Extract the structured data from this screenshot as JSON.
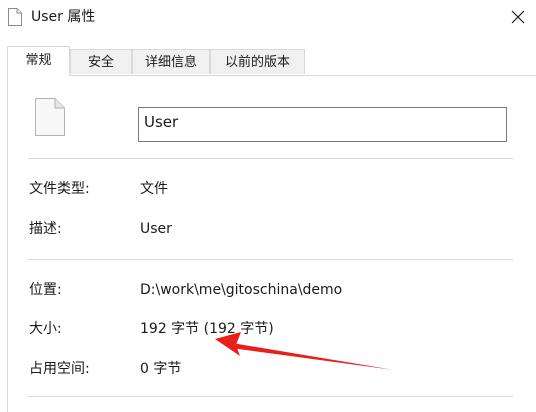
{
  "window": {
    "title": "User 属性"
  },
  "tabs": [
    {
      "label": "常规",
      "active": true
    },
    {
      "label": "安全",
      "active": false
    },
    {
      "label": "详细信息",
      "active": false
    },
    {
      "label": "以前的版本",
      "active": false
    }
  ],
  "general": {
    "file_name": "User",
    "type_label": "文件类型:",
    "type_value": "文件",
    "desc_label": "描述:",
    "desc_value": "User",
    "location_label": "位置:",
    "location_value": "D:\\work\\me\\gitoschina\\demo",
    "size_label": "大小:",
    "size_value": "192 字节 (192 字节)",
    "disk_label": "占用空间:",
    "disk_value": "0 字节"
  },
  "icons": {
    "title": "file-icon",
    "close": "close-icon",
    "file": "file-icon"
  },
  "annotation": {
    "arrow_color": "#e8201a"
  }
}
